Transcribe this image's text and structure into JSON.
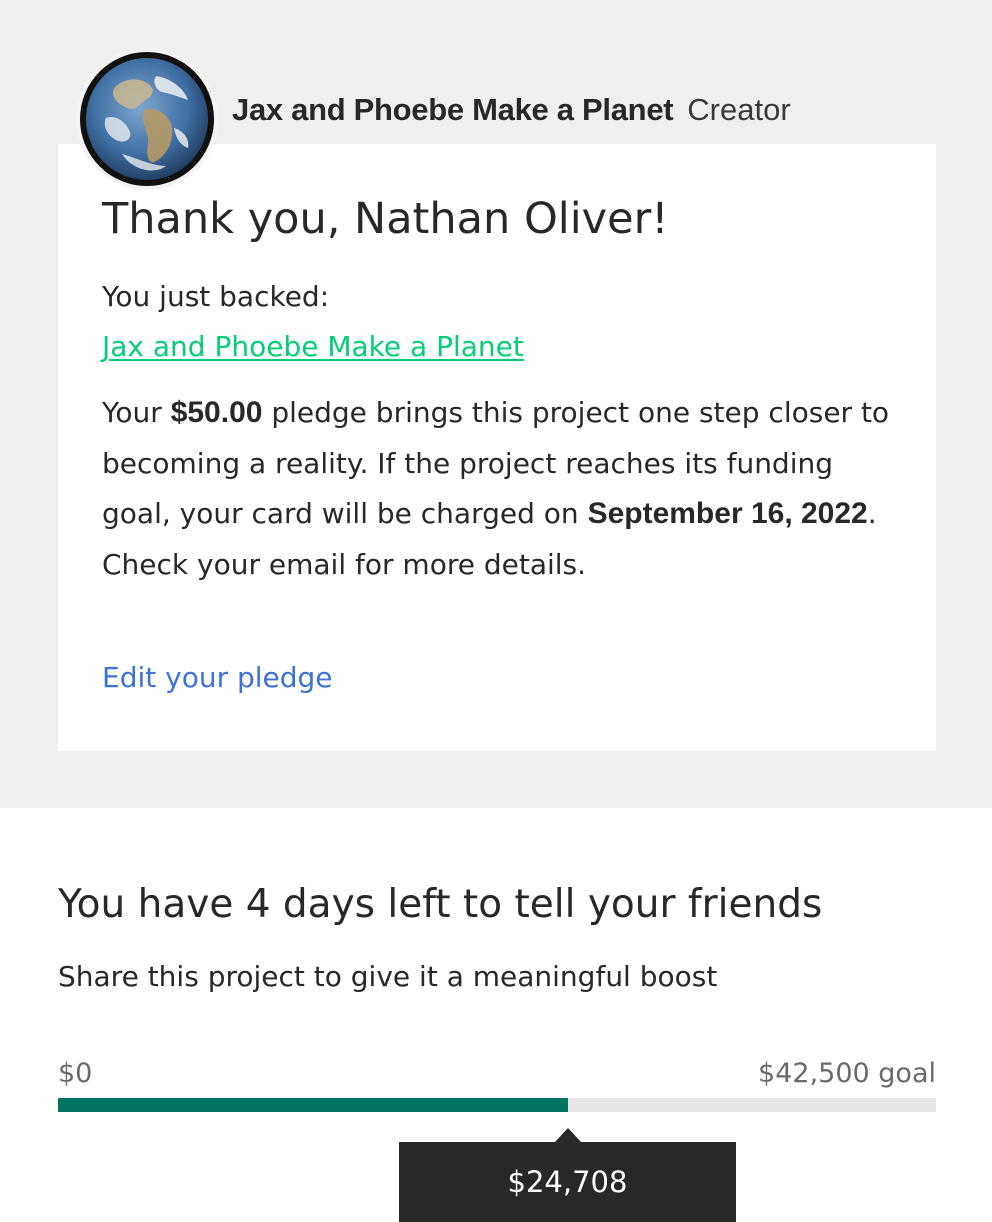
{
  "creator": {
    "name": "Jax and Phoebe Make a Planet",
    "role": "Creator",
    "avatar_icon": "earth-globe-avatar"
  },
  "thank_you": {
    "heading": "Thank you, Nathan Oliver!",
    "backed_label": "You just backed:",
    "project_link": "Jax and Phoebe Make a Planet",
    "pledge_prefix": "Your ",
    "pledge_amount": "$50.00",
    "pledge_middle": " pledge brings this project one step closer to becoming a reality. If the project reaches its funding goal, your card will be charged on ",
    "charge_date": "September 16, 2022",
    "pledge_suffix": ". Check your email for more details.",
    "edit_link": "Edit your pledge"
  },
  "share": {
    "heading": "You have 4 days left to tell your friends",
    "subheading": "Share this project to give it a meaningful boost"
  },
  "funding": {
    "min_label": "$0",
    "goal_label": "$42,500 goal",
    "pledged_label": "$24,708",
    "pledged_value": 24708,
    "goal_value": 42500,
    "progress_fraction": 0.5814
  },
  "colors": {
    "link_green": "#05ce78",
    "link_blue": "#3d73d9",
    "progress_green": "#037362",
    "tooltip_bg": "#282828"
  }
}
